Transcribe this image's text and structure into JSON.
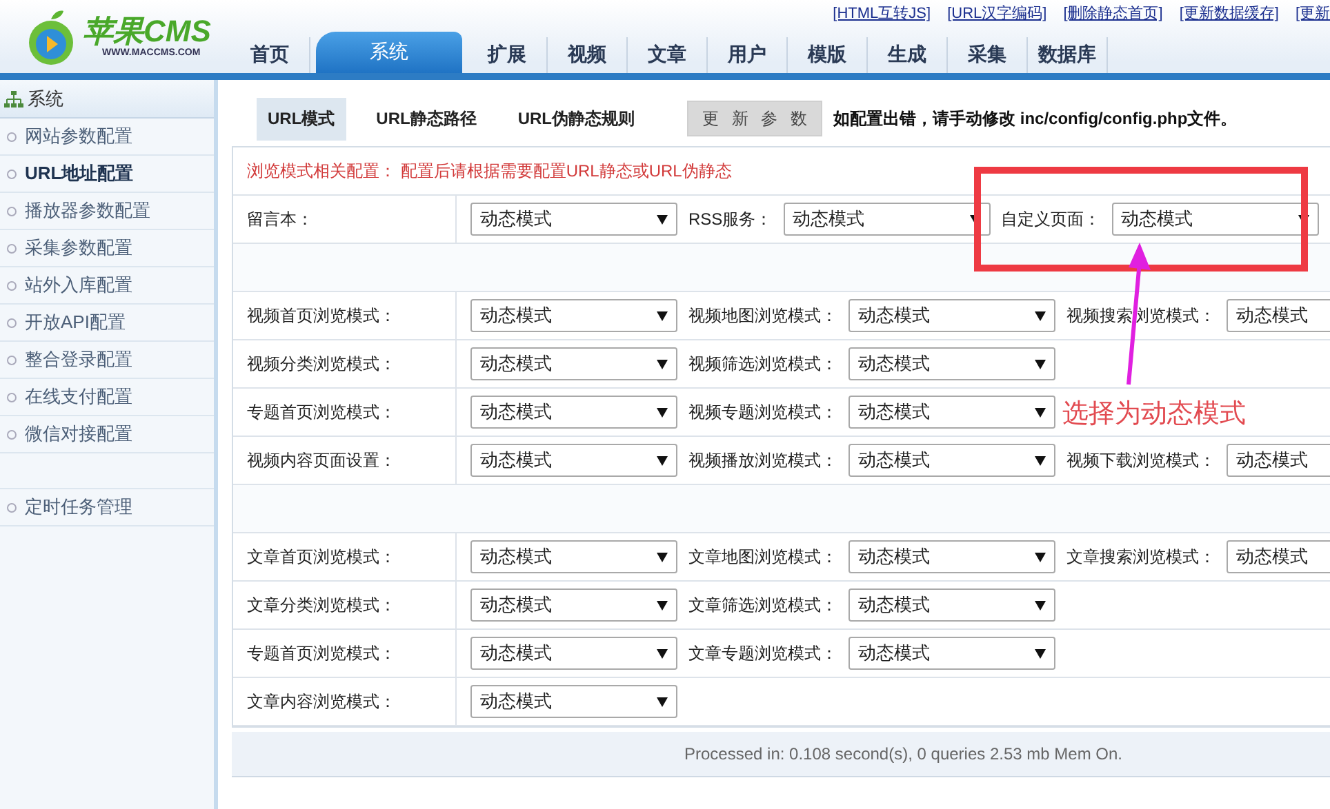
{
  "header": {
    "logo": {
      "name": "苹果CMS",
      "url": "WWW.MACCMS.COM"
    },
    "top_links": [
      "[HTML互转JS]",
      "[URL汉字编码]",
      "[删除静态首页]",
      "[更新数据缓存]",
      "[更新"
    ],
    "nav": [
      {
        "label": "首页",
        "selected": false
      },
      {
        "label": "系统",
        "selected": true
      },
      {
        "label": "扩展",
        "selected": false
      },
      {
        "label": "视频",
        "selected": false
      },
      {
        "label": "文章",
        "selected": false
      },
      {
        "label": "用户",
        "selected": false
      },
      {
        "label": "模版",
        "selected": false
      },
      {
        "label": "生成",
        "selected": false
      },
      {
        "label": "采集",
        "selected": false
      },
      {
        "label": "数据库",
        "selected": false
      }
    ]
  },
  "sidebar": {
    "title": "系统",
    "groups": [
      {
        "items": [
          {
            "label": "网站参数配置",
            "selected": false
          },
          {
            "label": "URL地址配置",
            "selected": true
          },
          {
            "label": "播放器参数配置",
            "selected": false
          },
          {
            "label": "采集参数配置",
            "selected": false
          },
          {
            "label": "站外入库配置",
            "selected": false
          },
          {
            "label": "开放API配置",
            "selected": false
          },
          {
            "label": "整合登录配置",
            "selected": false
          },
          {
            "label": "在线支付配置",
            "selected": false
          },
          {
            "label": "微信对接配置",
            "selected": false
          }
        ]
      },
      {
        "items": [
          {
            "label": "定时任务管理",
            "selected": false
          }
        ]
      }
    ]
  },
  "subtabs": [
    {
      "label": "URL模式",
      "selected": true
    },
    {
      "label": "URL静态路径",
      "selected": false
    },
    {
      "label": "URL伪静态规则",
      "selected": false
    }
  ],
  "update_button": "更 新 参 数",
  "notice": "如配置出错，请手动修改 inc/config/config.php文件。",
  "table": {
    "hint": "浏览模式相关配置： 配置后请根据需要配置URL静态或URL伪静态",
    "sections": [
      {
        "rows": [
          {
            "cells": [
              {
                "label": "留言本：",
                "value": "动态模式"
              },
              {
                "label": "RSS服务：",
                "value": "动态模式"
              },
              {
                "label": "自定义页面：",
                "value": "动态模式"
              }
            ]
          }
        ]
      },
      {
        "rows": [
          {
            "cells": [
              {
                "label": "视频首页浏览模式：",
                "value": "动态模式"
              },
              {
                "label": "视频地图浏览模式：",
                "value": "动态模式"
              },
              {
                "label": "视频搜索浏览模式：",
                "value": "动态模式"
              }
            ]
          },
          {
            "cells": [
              {
                "label": "视频分类浏览模式：",
                "value": "动态模式"
              },
              {
                "label": "视频筛选浏览模式：",
                "value": "动态模式"
              }
            ]
          },
          {
            "cells": [
              {
                "label": "专题首页浏览模式：",
                "value": "动态模式"
              },
              {
                "label": "视频专题浏览模式：",
                "value": "动态模式"
              }
            ]
          },
          {
            "cells": [
              {
                "label": "视频内容页面设置：",
                "value": "动态模式"
              },
              {
                "label": "视频播放浏览模式：",
                "value": "动态模式"
              },
              {
                "label": "视频下载浏览模式：",
                "value": "动态模式"
              }
            ]
          }
        ]
      },
      {
        "rows": [
          {
            "cells": [
              {
                "label": "文章首页浏览模式：",
                "value": "动态模式"
              },
              {
                "label": "文章地图浏览模式：",
                "value": "动态模式"
              },
              {
                "label": "文章搜索浏览模式：",
                "value": "动态模式"
              }
            ]
          },
          {
            "cells": [
              {
                "label": "文章分类浏览模式：",
                "value": "动态模式"
              },
              {
                "label": "文章筛选浏览模式：",
                "value": "动态模式"
              }
            ]
          },
          {
            "cells": [
              {
                "label": "专题首页浏览模式：",
                "value": "动态模式"
              },
              {
                "label": "文章专题浏览模式：",
                "value": "动态模式"
              }
            ]
          },
          {
            "cells": [
              {
                "label": "文章内容浏览模式：",
                "value": "动态模式"
              }
            ]
          }
        ]
      }
    ]
  },
  "footer": "Processed in: 0.108 second(s), 0 queries 2.53 mb Mem On.",
  "annotation": {
    "label": "选择为动态模式"
  }
}
